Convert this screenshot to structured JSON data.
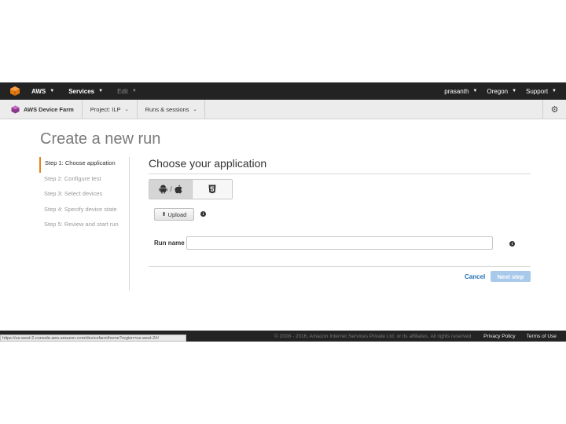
{
  "topbar": {
    "aws_label": "AWS",
    "services_label": "Services",
    "edit_label": "Edit",
    "user_label": "prasanth",
    "region_label": "Oregon",
    "support_label": "Support"
  },
  "subbar": {
    "service_name": "AWS Device Farm",
    "project_label": "Project: ILP",
    "runs_label": "Runs & sessions",
    "settings_icon": "gear-icon"
  },
  "page": {
    "title": "Create a new run"
  },
  "steps": [
    {
      "label": "Step 1: Choose application",
      "active": true
    },
    {
      "label": "Step 2: Configure test",
      "active": false
    },
    {
      "label": "Step 3: Select devices",
      "active": false
    },
    {
      "label": "Step 4: Specify device state",
      "active": false
    },
    {
      "label": "Step 5: Review and start run",
      "active": false
    }
  ],
  "panel": {
    "title": "Choose your application",
    "platform_separator": "/",
    "upload_label": "Upload",
    "run_name_label": "Run name",
    "run_name_value": "",
    "cancel_label": "Cancel",
    "next_label": "Next step"
  },
  "footer": {
    "copyright": "© 2008 - 2016, Amazon Internet Services Private Ltd. or its affiliates. All rights reserved.",
    "privacy": "Privacy Policy",
    "terms": "Terms of Use",
    "status_url": "https://us-west-2.console.aws.amazon.com/devicefarm/home?region=us-west-2#/"
  },
  "colors": {
    "accent": "#e4821c",
    "link": "#1f6fb2",
    "topbar": "#232323"
  }
}
